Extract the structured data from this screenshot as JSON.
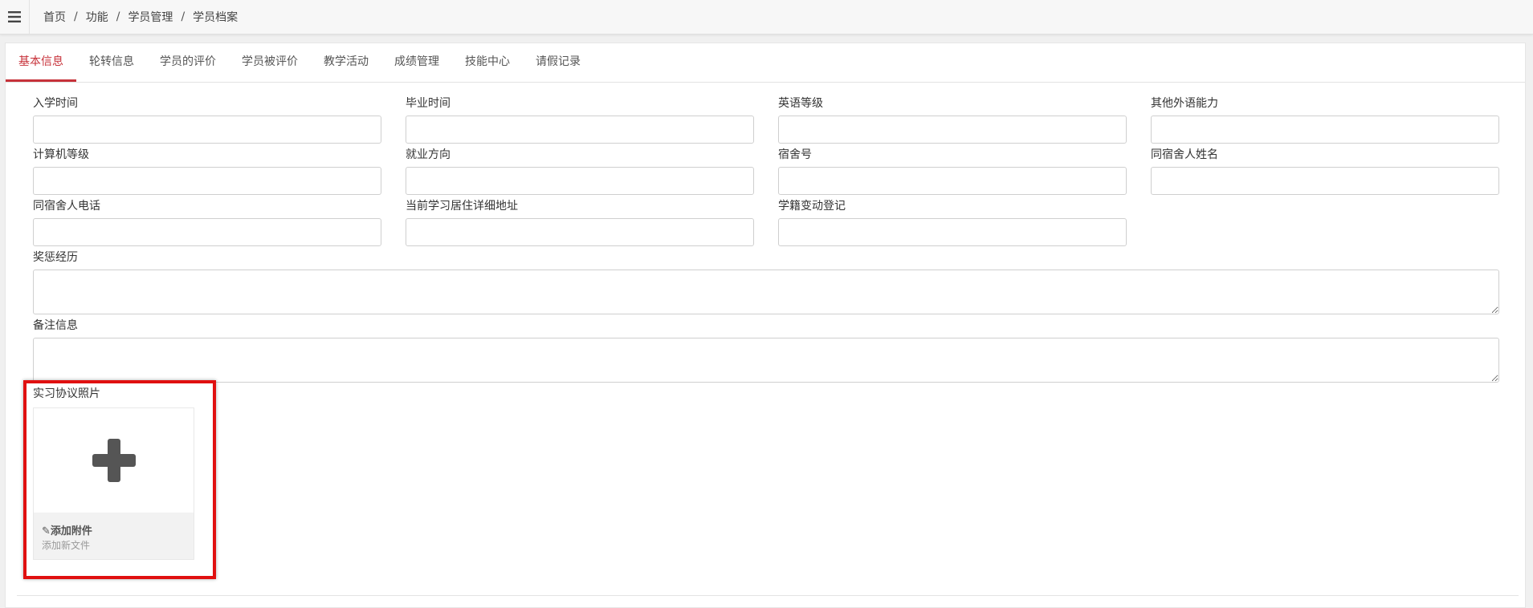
{
  "breadcrumb": [
    "首页",
    "功能",
    "学员管理",
    "学员档案"
  ],
  "tabs": [
    {
      "label": "基本信息",
      "active": true
    },
    {
      "label": "轮转信息",
      "active": false
    },
    {
      "label": "学员的评价",
      "active": false
    },
    {
      "label": "学员被评价",
      "active": false
    },
    {
      "label": "教学活动",
      "active": false
    },
    {
      "label": "成绩管理",
      "active": false
    },
    {
      "label": "技能中心",
      "active": false
    },
    {
      "label": "请假记录",
      "active": false
    }
  ],
  "fields": {
    "enroll_time": {
      "label": "入学时间",
      "value": ""
    },
    "graduate_time": {
      "label": "毕业时间",
      "value": ""
    },
    "english_level": {
      "label": "英语等级",
      "value": ""
    },
    "other_language": {
      "label": "其他外语能力",
      "value": ""
    },
    "computer_level": {
      "label": "计算机等级",
      "value": ""
    },
    "employment_direction": {
      "label": "就业方向",
      "value": ""
    },
    "dorm_number": {
      "label": "宿舍号",
      "value": ""
    },
    "roommate_name": {
      "label": "同宿舍人姓名",
      "value": ""
    },
    "roommate_phone": {
      "label": "同宿舍人电话",
      "value": ""
    },
    "current_address": {
      "label": "当前学习居住详细地址",
      "value": ""
    },
    "status_change": {
      "label": "学籍变动登记",
      "value": ""
    },
    "rewards_punishments": {
      "label": "奖惩经历",
      "value": ""
    },
    "remarks": {
      "label": "备注信息",
      "value": ""
    }
  },
  "upload": {
    "label": "实习协议照片",
    "title": "✎添加附件",
    "subtitle": "添加新文件"
  },
  "colors": {
    "accent": "#c7323a",
    "highlight": "#e01010"
  }
}
